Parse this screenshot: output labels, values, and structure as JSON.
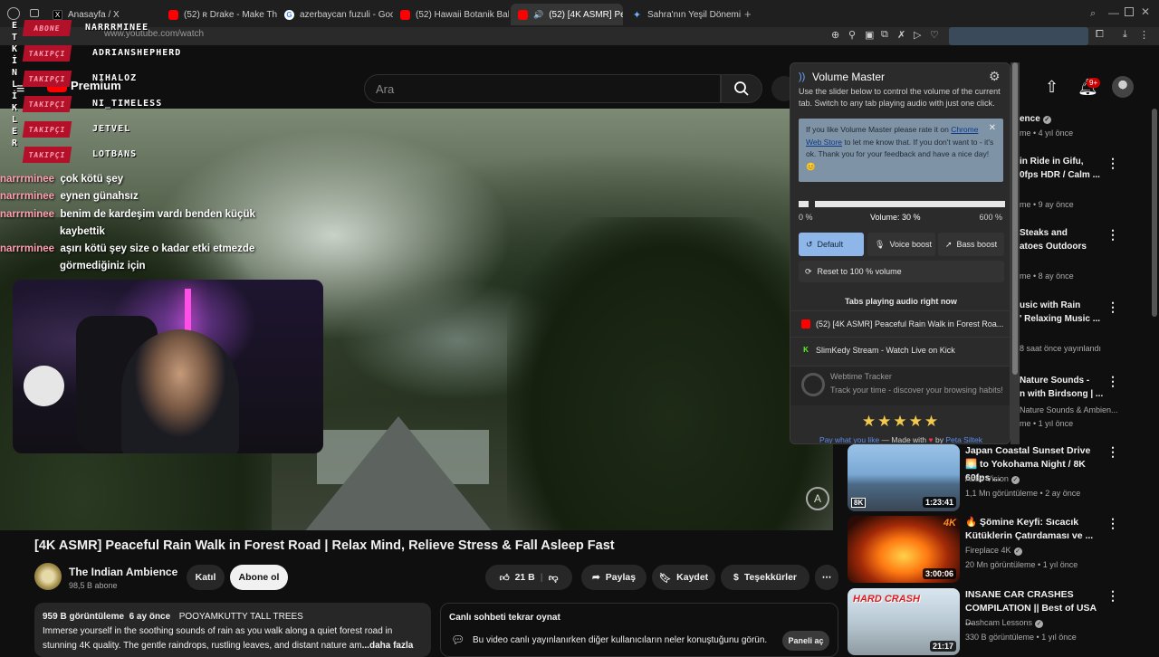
{
  "browser": {
    "tabs": [
      {
        "label": "Anasayfa / X",
        "icon": "x-logo-icon"
      },
      {
        "label": "(52) ʀ Drake - Make Them",
        "icon": "youtube-icon"
      },
      {
        "label": "azerbaycan fuzuli - Google",
        "icon": "google-icon"
      },
      {
        "label": "(52) Hawaii Botanik Bahçe",
        "icon": "youtube-icon"
      },
      {
        "label": "(52) [4K ASMR] Peace",
        "icon": "youtube-icon"
      },
      {
        "label": "Sahra'nın Yeşil Dönemi ve",
        "icon": "star-icon"
      }
    ],
    "new_tab": "+",
    "url": "www.youtube.com/watch"
  },
  "youtube": {
    "logo_text": "Premium",
    "search_placeholder": "Ara",
    "notification_count": "9+",
    "video_title": "[4K ASMR] Peaceful Rain Walk in Forest Road | Relax Mind, Relieve Stress & Fall Asleep Fast",
    "channel": {
      "name": "The Indian Ambience",
      "subs": "98,5 B abone"
    },
    "join_label": "Katıl",
    "subscribe_label": "Abone ol",
    "likes": "21 B",
    "share_label": "Paylaş",
    "save_label": "Kaydet",
    "thanks_label": "Teşekkürler",
    "description": {
      "views": "959 B görüntüleme",
      "age": "6 ay önce",
      "tags": "POOYAMKUTTY TALL TREES",
      "line1": "Immerse yourself in the soothing sounds of rain as you walk along a quiet forest road in",
      "line2": "stunning 4K quality. The gentle raindrops, rustling leaves, and distant nature am",
      "more": "...daha fazla"
    },
    "live_chat": {
      "title": "Canlı sohbeti tekrar oynat",
      "text": "Bu video canlı yayınlanırken diğer kullanıcıların neler konuştuğunu görün.",
      "button": "Paneli aç"
    }
  },
  "stream_overlay": {
    "vertical_label": "ETKİNLİKLER",
    "followers": [
      {
        "badge": "ABONE",
        "name": "NARRRMINEE"
      },
      {
        "badge": "TAKIPÇI",
        "name": "ADRIANSHEPHERD"
      },
      {
        "badge": "TAKIPÇI",
        "name": "NIHALOZ"
      },
      {
        "badge": "TAKIPÇI",
        "name": "NI_TIMELESS"
      },
      {
        "badge": "TAKIPÇI",
        "name": "JETVEL"
      },
      {
        "badge": "TAKIPÇI",
        "name": "LOTBANS"
      }
    ],
    "chat": [
      {
        "user": "narrrminee",
        "msg": "çok kötü şey"
      },
      {
        "user": "narrrminee",
        "msg": "eynen günahsız"
      },
      {
        "user": "narrrminee",
        "msg": "benim de kardeşim vardı benden küçük"
      },
      {
        "user": "",
        "msg": "kaybettik"
      },
      {
        "user": "narrrminee",
        "msg": "aşırı kötü şey size o kadar etki etmezde"
      },
      {
        "user": "",
        "msg": "görmediğiniz için"
      }
    ]
  },
  "volume_master": {
    "title": "Volume Master",
    "description": "Use the slider below to control the volume of the current tab. Switch to any tab playing audio with just one click.",
    "rate_pre": "If you like Volume Master please rate it on",
    "rate_link": "Chrome Web Store",
    "rate_post": "to let me know that. If you don't want to - it's ok. Thank you for your feedback and have a nice day! 😊",
    "volume_percent": 30,
    "volume_max": 600,
    "min_label": "0 %",
    "volume_label": "Volume: 30 %",
    "max_label": "600 %",
    "default_label": "Default",
    "voice_label": "Voice boost",
    "bass_label": "Bass boost",
    "reset_label": "Reset to 100 % volume",
    "tabs_title": "Tabs playing audio right now",
    "audio_tabs": [
      {
        "label": "(52) [4K ASMR] Peaceful Rain Walk in Forest Roa...",
        "icon": "youtube-icon"
      },
      {
        "label": "SlimKedy Stream - Watch Live on Kick",
        "icon": "kick-icon"
      }
    ],
    "ad_name": "Webtime Tracker",
    "ad_desc": "Track your time - discover your browsing habits!",
    "stars": "★★★★★",
    "footer_link": "Pay what you like",
    "footer_mid": "— Made with",
    "footer_by": "by",
    "footer_author": "Peta Siltek"
  },
  "sidebar": {
    "partial": [
      {
        "line": "ence",
        "sub": "me • 4 yıl önce"
      },
      {
        "line": "in Ride in Gifu,",
        "line2": "0fps HDR / Calm ...",
        "sub": "me • 9 ay önce"
      },
      {
        "line": "Steaks and",
        "line2": "atoes Outdoors",
        "sub": "me • 8 ay önce"
      },
      {
        "line": "usic with Rain",
        "line2": "' Relaxing Music ...",
        "sub": "8 saat önce yayınlandı"
      },
      {
        "line": "Nature Sounds -",
        "line2": "n with Birdsong | ...",
        "sub": "Nature Sounds & Ambien...",
        "sub2": "me • 1 yıl önce"
      }
    ],
    "recs": [
      {
        "title": "Japan Coastal Sunset Drive 🌅 to Yokohama Night / 8K 60fps ...",
        "channel": "Abao Vision",
        "stats": "1,1 Mn görüntüleme • 2 ay önce",
        "duration": "1:23:41",
        "badge": "8K"
      },
      {
        "title": "🔥 Şömine Keyfi: Sıcacık Kütüklerin Çatırdaması ve ...",
        "channel": "Fireplace 4K",
        "stats": "20 Mn görüntüleme • 1 yıl önce",
        "duration": "3:00:06",
        "badge": "4K"
      },
      {
        "title": "INSANE CAR CRASHES COMPILATION || Best of USA ...",
        "channel": "Dashcam Lessons",
        "stats": "330 B görüntüleme • 1 yıl önce",
        "duration": "21:17",
        "badge": "HARD CRASH"
      }
    ]
  }
}
